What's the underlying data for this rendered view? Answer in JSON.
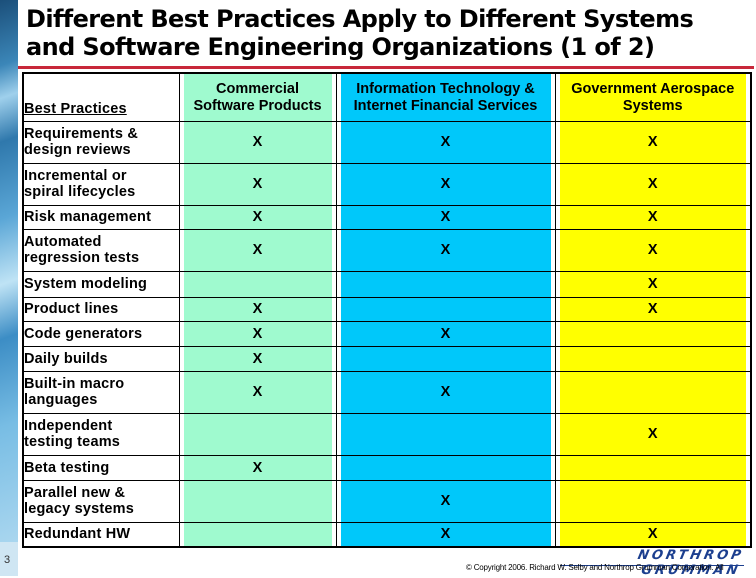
{
  "slide": {
    "title_line1": "Different Best Practices Apply to Different Systems",
    "title_line2": "and Software Engineering Organizations (1 of 2)",
    "page_number": "3",
    "logo_text": "NORTHROP GRUMMAN",
    "copyright": "© Copyright 2006. Richard W. Selby and Northrop Grumman Corporation. All"
  },
  "colors": {
    "commercial": "#9ffacf",
    "it_financial": "#00c8fa",
    "gov_aerospace": "#ffff00",
    "title_rule": "#c8283a"
  },
  "table": {
    "headers": [
      "Best Practices",
      "Commercial Software Products",
      "Information Technology & Internet Financial Services",
      "Government Aerospace Systems"
    ],
    "header_lines": {
      "commercial": [
        "Commercial",
        "Software Products"
      ],
      "it_financial": [
        "Information Technology &",
        "Internet Financial Services"
      ],
      "gov_aerospace": [
        "Government Aerospace",
        "Systems"
      ]
    },
    "rows": [
      {
        "practice": [
          "Requirements &",
          "design reviews"
        ],
        "commercial": "X",
        "it_financial": "X",
        "gov_aerospace": "X"
      },
      {
        "practice": [
          "Incremental or",
          "spiral lifecycles"
        ],
        "commercial": "X",
        "it_financial": "X",
        "gov_aerospace": "X"
      },
      {
        "practice": [
          "Risk management"
        ],
        "commercial": "X",
        "it_financial": "X",
        "gov_aerospace": "X"
      },
      {
        "practice": [
          "Automated",
          "regression tests"
        ],
        "commercial": "X",
        "it_financial": "X",
        "gov_aerospace": "X"
      },
      {
        "practice": [
          "System modeling"
        ],
        "commercial": "",
        "it_financial": "",
        "gov_aerospace": "X"
      },
      {
        "practice": [
          "Product lines"
        ],
        "commercial": "X",
        "it_financial": "",
        "gov_aerospace": "X"
      },
      {
        "practice": [
          "Code generators"
        ],
        "commercial": "X",
        "it_financial": "X",
        "gov_aerospace": ""
      },
      {
        "practice": [
          "Daily builds"
        ],
        "commercial": "X",
        "it_financial": "",
        "gov_aerospace": ""
      },
      {
        "practice": [
          "Built-in macro",
          "languages"
        ],
        "commercial": "X",
        "it_financial": "X",
        "gov_aerospace": ""
      },
      {
        "practice": [
          "Independent",
          "testing teams"
        ],
        "commercial": "",
        "it_financial": "",
        "gov_aerospace": "X"
      },
      {
        "practice": [
          "Beta testing"
        ],
        "commercial": "X",
        "it_financial": "",
        "gov_aerospace": ""
      },
      {
        "practice": [
          "Parallel new &",
          "legacy systems"
        ],
        "commercial": "",
        "it_financial": "X",
        "gov_aerospace": ""
      },
      {
        "practice": [
          "Redundant HW"
        ],
        "commercial": "",
        "it_financial": "X",
        "gov_aerospace": "X"
      }
    ]
  }
}
